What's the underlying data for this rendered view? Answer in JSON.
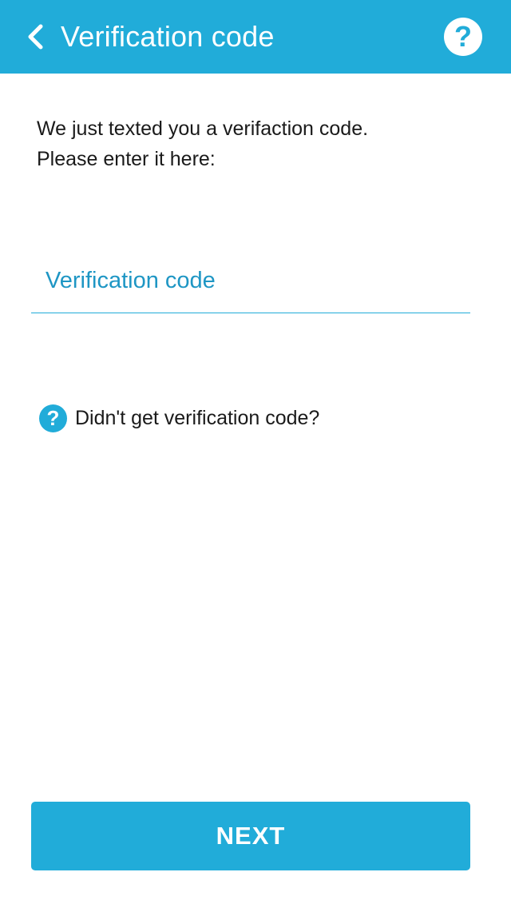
{
  "header": {
    "title": "Verification code",
    "back_icon": "chevron-left-icon",
    "help_icon": "question-circle-icon",
    "help_glyph": "?"
  },
  "instructions": {
    "line1": "We just texted you a verifaction code.",
    "line2": "Please enter it here:"
  },
  "code_input": {
    "placeholder": "Verification code",
    "value": ""
  },
  "help_link": {
    "icon": "question-circle-icon",
    "glyph": "?",
    "label": "Didn't get verification code?"
  },
  "next_button": {
    "label": "NEXT"
  },
  "colors": {
    "accent": "#21acd9",
    "placeholder": "#1e96c4",
    "text": "#1a1a1a",
    "background": "#ffffff"
  }
}
